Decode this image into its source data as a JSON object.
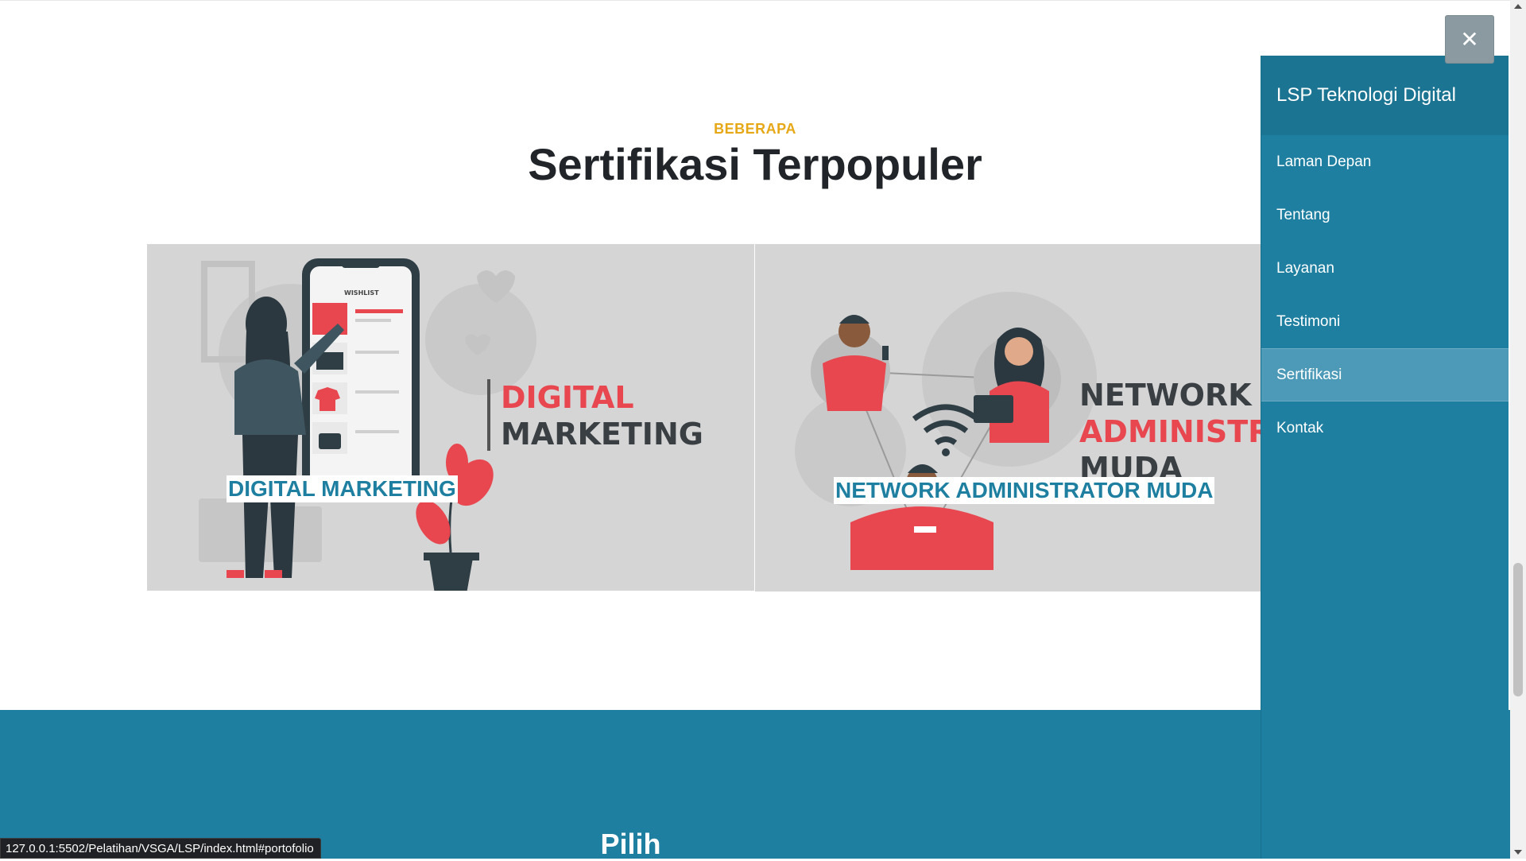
{
  "section": {
    "eyebrow": "BEBERAPA",
    "title": "Sertifikasi Terpopuler"
  },
  "cards": [
    {
      "label": "DIGITAL MARKETING",
      "image_text": [
        "DIGITAL",
        "MARKETING"
      ],
      "phone_header": "WISHLIST"
    },
    {
      "label": "NETWORK ADMINISTRATOR MUDA",
      "image_text": [
        "NETWORK",
        "ADMINISTRATOR",
        "MUDA"
      ]
    }
  ],
  "next_section": {
    "title": "Pilih"
  },
  "sidebar": {
    "brand": "LSP Teknologi Digital",
    "items": [
      {
        "label": "Laman Depan",
        "active": false
      },
      {
        "label": "Tentang",
        "active": false
      },
      {
        "label": "Layanan",
        "active": false
      },
      {
        "label": "Testimoni",
        "active": false
      },
      {
        "label": "Sertifikasi",
        "active": true
      },
      {
        "label": "Kontak",
        "active": false
      }
    ],
    "close_icon": "close-icon"
  },
  "status_bar": {
    "url": "127.0.0.1:5502/Pelatihan/VSGA/LSP/index.html#portofolio"
  },
  "colors": {
    "accent": "#1e7fa0",
    "eyebrow": "#e6a817",
    "illustration_red": "#e8474f",
    "illustration_dark": "#2f3d45"
  }
}
